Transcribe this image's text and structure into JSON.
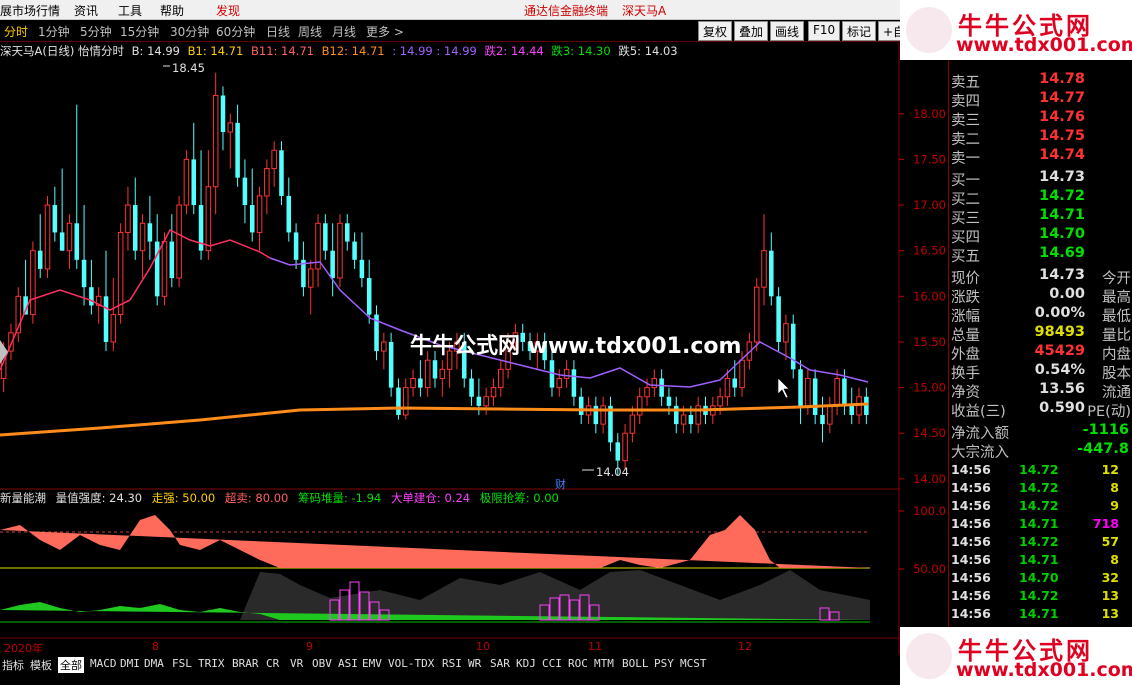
{
  "menubar": {
    "items": [
      "展市场行情",
      "资讯",
      "工具",
      "帮助",
      "发现"
    ],
    "center1": "通达信金融终端",
    "center2": "深天马A"
  },
  "periods": [
    "分时",
    "1分钟",
    "5分钟",
    "15分钟",
    "30分钟",
    "60分钟",
    "日线",
    "周线",
    "月线",
    "更多 >"
  ],
  "toolbar": {
    "b1": "复权",
    "b2": "叠加",
    "b3": "画线",
    "b4": "F10",
    "b5": "标记",
    "b6": "+自选"
  },
  "info": {
    "name": "深天马A(日线) 怡情分时",
    "b": "B: 14.99",
    "b1": "B1: 14.71",
    "b11": "B11: 14.71",
    "b12": "B12: 14.71",
    "v": ": 14.99 : 14.99",
    "d2": "跌2: 14.44",
    "d3": "跌3: 14.30",
    "d5": "跌5: 14.03"
  },
  "price_axis": [
    "18.00",
    "17.50",
    "17.00",
    "16.50",
    "16.00",
    "15.50",
    "15.00",
    "14.50",
    "14.00"
  ],
  "annotations": {
    "high": "18.45",
    "low": "14.04",
    "cai": "财"
  },
  "watermark": "牛牛公式网  www.tdx001.com",
  "indicator": {
    "name": "新量能潮",
    "strength": "量值强度: 24.30",
    "walk": "走强: 50.00",
    "over": "超卖: 80.00",
    "chip": "筹码堆量: -1.94",
    "big": "大单建仓: 0.24",
    "limit": "极限抢筹: 0.00"
  },
  "ind_axis": [
    "100.0",
    "50.00"
  ],
  "date_axis": {
    "year": "2020年",
    "m8": "8",
    "m9": "9",
    "m10": "10",
    "m11": "11",
    "m12": "12"
  },
  "bottombar": [
    "指标",
    "模板",
    "全部",
    "MACD",
    "DMI",
    "DMA",
    "FSL",
    "TRIX",
    "BRAR",
    "CR",
    "VR",
    "OBV",
    "ASI",
    "EMV",
    "VOL-TDX",
    "RSI",
    "WR",
    "SAR",
    "KDJ",
    "CCI",
    "ROC",
    "MTM",
    "BOLL",
    "PSY",
    "MCST"
  ],
  "quote": {
    "sell": [
      {
        "k": "卖五",
        "v": "14.78"
      },
      {
        "k": "卖四",
        "v": "14.77"
      },
      {
        "k": "卖三",
        "v": "14.76"
      },
      {
        "k": "卖二",
        "v": "14.75"
      },
      {
        "k": "卖一",
        "v": "14.74"
      }
    ],
    "buy": [
      {
        "k": "买一",
        "v": "14.73"
      },
      {
        "k": "买二",
        "v": "14.72"
      },
      {
        "k": "买三",
        "v": "14.71"
      },
      {
        "k": "买四",
        "v": "14.70"
      },
      {
        "k": "买五",
        "v": "14.69"
      }
    ],
    "stats": [
      {
        "k": "现价",
        "v": "14.73",
        "k2": "今开"
      },
      {
        "k": "涨跌",
        "v": "0.00",
        "k2": "最高"
      },
      {
        "k": "涨幅",
        "v": "0.00%",
        "k2": "最低"
      },
      {
        "k": "总量",
        "v": "98493",
        "k2": "量比"
      },
      {
        "k": "外盘",
        "v": "45429",
        "k2": "内盘"
      },
      {
        "k": "换手",
        "v": "0.54%",
        "k2": "股本"
      },
      {
        "k": "净资",
        "v": "13.56",
        "k2": "流通"
      },
      {
        "k": "收益(三)",
        "v": "0.590",
        "k2": "PE(动)"
      }
    ],
    "flows": [
      {
        "k": "净流入额",
        "v": "-1116"
      },
      {
        "k": "大宗流入",
        "v": "-447.8"
      }
    ],
    "ticks": [
      {
        "t": "14:56",
        "p": "14.72",
        "q": "12",
        "c": "#e0e000"
      },
      {
        "t": "14:56",
        "p": "14.72",
        "q": "8",
        "c": "#e0e000"
      },
      {
        "t": "14:56",
        "p": "14.72",
        "q": "9",
        "c": "#e0e000"
      },
      {
        "t": "14:56",
        "p": "14.71",
        "q": "718",
        "c": "#ff00ff"
      },
      {
        "t": "14:56",
        "p": "14.72",
        "q": "57",
        "c": "#e0e000"
      },
      {
        "t": "14:56",
        "p": "14.71",
        "q": "8",
        "c": "#e0e000"
      },
      {
        "t": "14:56",
        "p": "14.70",
        "q": "32",
        "c": "#e0e000"
      },
      {
        "t": "14:56",
        "p": "14.72",
        "q": "13",
        "c": "#e0e000"
      },
      {
        "t": "14:56",
        "p": "14.71",
        "q": "13",
        "c": "#e0e000"
      }
    ]
  },
  "logo": {
    "line1": "牛牛公式网",
    "line2": "www.tdx001.com"
  },
  "colors": {
    "up": "#ff3232",
    "down": "#54ffff",
    "ma_red": "#ff3060",
    "ma_purple": "#a060ff",
    "ma_orange": "#ff8c1a",
    "positive": "#ff3232",
    "negative": "#00e000"
  },
  "chart_data": {
    "type": "candlestick",
    "ylim": [
      13.9,
      18.6
    ],
    "candles": [
      [
        15.1,
        15.5,
        14.95,
        15.4
      ],
      [
        15.4,
        15.7,
        15.3,
        15.6
      ],
      [
        15.6,
        16.1,
        15.5,
        16.0
      ],
      [
        16.0,
        16.4,
        15.8,
        15.8
      ],
      [
        15.8,
        16.6,
        15.7,
        16.5
      ],
      [
        16.5,
        16.9,
        16.2,
        16.3
      ],
      [
        16.3,
        17.1,
        16.2,
        17.0
      ],
      [
        17.0,
        17.2,
        16.6,
        16.7
      ],
      [
        16.7,
        17.4,
        16.5,
        16.5
      ],
      [
        16.5,
        16.9,
        16.3,
        16.8
      ],
      [
        16.8,
        18.1,
        16.3,
        16.4
      ],
      [
        16.4,
        17.0,
        15.9,
        16.1
      ],
      [
        16.1,
        16.4,
        15.8,
        15.9
      ],
      [
        15.9,
        16.1,
        15.7,
        16.0
      ],
      [
        16.0,
        16.5,
        15.4,
        15.5
      ],
      [
        15.5,
        16.2,
        15.4,
        15.8
      ],
      [
        15.8,
        16.8,
        15.7,
        16.7
      ],
      [
        16.7,
        17.2,
        16.5,
        17.0
      ],
      [
        17.0,
        17.3,
        16.4,
        16.5
      ],
      [
        16.5,
        16.9,
        16.2,
        16.8
      ],
      [
        16.8,
        17.1,
        16.4,
        16.6
      ],
      [
        16.6,
        16.9,
        15.9,
        16.0
      ],
      [
        16.0,
        16.7,
        15.9,
        16.6
      ],
      [
        16.6,
        16.9,
        16.1,
        16.2
      ],
      [
        16.2,
        17.1,
        16.1,
        17.0
      ],
      [
        17.0,
        17.6,
        16.9,
        17.5
      ],
      [
        17.5,
        17.9,
        16.9,
        17.0
      ],
      [
        17.0,
        17.6,
        16.4,
        16.5
      ],
      [
        16.5,
        17.6,
        16.4,
        17.2
      ],
      [
        17.2,
        18.45,
        16.9,
        18.2
      ],
      [
        18.2,
        18.3,
        17.6,
        17.8
      ],
      [
        17.8,
        18.0,
        17.4,
        17.9
      ],
      [
        17.9,
        18.1,
        17.2,
        17.3
      ],
      [
        17.3,
        17.5,
        16.8,
        17.0
      ],
      [
        17.0,
        17.4,
        16.6,
        16.7
      ],
      [
        16.7,
        17.2,
        16.5,
        17.1
      ],
      [
        17.1,
        17.5,
        16.9,
        17.4
      ],
      [
        17.4,
        17.7,
        17.2,
        17.6
      ],
      [
        17.6,
        17.7,
        17.0,
        17.1
      ],
      [
        17.1,
        17.3,
        16.6,
        16.7
      ],
      [
        16.7,
        16.8,
        16.3,
        16.4
      ],
      [
        16.4,
        16.6,
        16.0,
        16.1
      ],
      [
        16.1,
        16.4,
        15.8,
        16.3
      ],
      [
        16.3,
        16.9,
        16.1,
        16.8
      ],
      [
        16.8,
        16.9,
        16.4,
        16.5
      ],
      [
        16.5,
        16.8,
        16.0,
        16.2
      ],
      [
        16.2,
        16.9,
        16.1,
        16.8
      ],
      [
        16.8,
        16.9,
        16.5,
        16.6
      ],
      [
        16.6,
        16.7,
        16.3,
        16.4
      ],
      [
        16.4,
        16.7,
        16.1,
        16.2
      ],
      [
        16.2,
        16.4,
        15.7,
        15.8
      ],
      [
        15.8,
        15.9,
        15.3,
        15.4
      ],
      [
        15.4,
        15.6,
        15.2,
        15.5
      ],
      [
        15.5,
        15.6,
        14.9,
        15.0
      ],
      [
        15.0,
        15.1,
        14.65,
        14.7
      ],
      [
        14.7,
        15.1,
        14.65,
        15.0
      ],
      [
        15.0,
        15.2,
        14.9,
        15.1
      ],
      [
        15.1,
        15.3,
        14.9,
        15.0
      ],
      [
        15.0,
        15.4,
        14.9,
        15.3
      ],
      [
        15.3,
        15.4,
        15.0,
        15.1
      ],
      [
        15.1,
        15.3,
        14.9,
        15.2
      ],
      [
        15.2,
        15.5,
        15.0,
        15.4
      ],
      [
        15.4,
        15.6,
        15.2,
        15.5
      ],
      [
        15.5,
        15.6,
        15.0,
        15.1
      ],
      [
        15.1,
        15.2,
        14.8,
        14.9
      ],
      [
        14.9,
        15.1,
        14.7,
        14.8
      ],
      [
        14.8,
        15.0,
        14.7,
        14.9
      ],
      [
        14.9,
        15.1,
        14.8,
        15.0
      ],
      [
        15.0,
        15.3,
        14.9,
        15.2
      ],
      [
        15.2,
        15.6,
        15.1,
        15.5
      ],
      [
        15.5,
        15.7,
        15.4,
        15.6
      ],
      [
        15.6,
        15.7,
        15.4,
        15.5
      ],
      [
        15.5,
        15.6,
        15.3,
        15.4
      ],
      [
        15.4,
        15.6,
        15.2,
        15.5
      ],
      [
        15.5,
        15.6,
        15.2,
        15.3
      ],
      [
        15.3,
        15.4,
        14.9,
        15.0
      ],
      [
        15.0,
        15.2,
        14.9,
        15.1
      ],
      [
        15.1,
        15.3,
        15.0,
        15.2
      ],
      [
        15.2,
        15.3,
        14.8,
        14.9
      ],
      [
        14.9,
        15.0,
        14.6,
        14.7
      ],
      [
        14.7,
        14.9,
        14.6,
        14.8
      ],
      [
        14.8,
        14.9,
        14.5,
        14.6
      ],
      [
        14.6,
        14.9,
        14.5,
        14.8
      ],
      [
        14.8,
        14.9,
        14.3,
        14.4
      ],
      [
        14.4,
        14.5,
        14.04,
        14.2
      ],
      [
        14.2,
        14.6,
        14.1,
        14.5
      ],
      [
        14.5,
        14.8,
        14.4,
        14.7
      ],
      [
        14.7,
        15.0,
        14.6,
        14.9
      ],
      [
        14.9,
        15.1,
        14.8,
        15.0
      ],
      [
        15.0,
        15.2,
        14.9,
        15.1
      ],
      [
        15.1,
        15.2,
        14.8,
        14.9
      ],
      [
        14.9,
        15.0,
        14.7,
        14.8
      ],
      [
        14.8,
        14.9,
        14.5,
        14.6
      ],
      [
        14.6,
        14.8,
        14.5,
        14.7
      ],
      [
        14.7,
        14.8,
        14.5,
        14.6
      ],
      [
        14.6,
        14.9,
        14.5,
        14.8
      ],
      [
        14.8,
        14.9,
        14.6,
        14.7
      ],
      [
        14.7,
        14.9,
        14.6,
        14.8
      ],
      [
        14.8,
        15.0,
        14.7,
        14.9
      ],
      [
        14.9,
        15.2,
        14.8,
        15.1
      ],
      [
        15.1,
        15.3,
        14.9,
        15.0
      ],
      [
        15.0,
        15.4,
        14.9,
        15.3
      ],
      [
        15.3,
        15.6,
        15.2,
        15.5
      ],
      [
        15.5,
        16.2,
        15.4,
        16.1
      ],
      [
        16.1,
        16.9,
        15.9,
        16.5
      ],
      [
        16.5,
        16.7,
        15.9,
        16.0
      ],
      [
        16.0,
        16.1,
        15.4,
        15.5
      ],
      [
        15.5,
        15.8,
        15.3,
        15.7
      ],
      [
        15.7,
        15.8,
        15.1,
        15.2
      ],
      [
        15.2,
        15.3,
        14.6,
        14.8
      ],
      [
        14.8,
        15.2,
        14.7,
        15.1
      ],
      [
        15.1,
        15.2,
        14.6,
        14.7
      ],
      [
        14.7,
        14.9,
        14.4,
        14.6
      ],
      [
        14.6,
        14.9,
        14.5,
        14.8
      ],
      [
        14.8,
        15.2,
        14.7,
        15.1
      ],
      [
        15.1,
        15.2,
        14.7,
        14.8
      ],
      [
        14.8,
        15.0,
        14.6,
        14.7
      ],
      [
        14.7,
        15.0,
        14.6,
        14.9
      ],
      [
        14.9,
        15.0,
        14.6,
        14.7
      ]
    ],
    "ma_purple_points": [
      [
        270,
        258
      ],
      [
        290,
        265
      ],
      [
        320,
        262
      ],
      [
        340,
        290
      ],
      [
        370,
        318
      ],
      [
        400,
        330
      ],
      [
        440,
        345
      ],
      [
        480,
        355
      ],
      [
        520,
        365
      ],
      [
        560,
        375
      ],
      [
        590,
        378
      ],
      [
        620,
        368
      ],
      [
        650,
        385
      ],
      [
        690,
        387
      ],
      [
        720,
        380
      ],
      [
        760,
        342
      ],
      [
        790,
        358
      ],
      [
        810,
        370
      ],
      [
        840,
        375
      ],
      [
        868,
        382
      ]
    ],
    "ma_red_points": [
      [
        0,
        370
      ],
      [
        30,
        300
      ],
      [
        60,
        290
      ],
      [
        90,
        300
      ],
      [
        110,
        310
      ],
      [
        130,
        300
      ],
      [
        150,
        268
      ],
      [
        170,
        230
      ],
      [
        190,
        240
      ],
      [
        210,
        246
      ],
      [
        230,
        240
      ],
      [
        260,
        252
      ],
      [
        270,
        258
      ]
    ],
    "ma_orange_points": [
      [
        0,
        435
      ],
      [
        100,
        428
      ],
      [
        200,
        420
      ],
      [
        300,
        410
      ],
      [
        400,
        408
      ],
      [
        500,
        409
      ],
      [
        600,
        410
      ],
      [
        700,
        410
      ],
      [
        800,
        407
      ],
      [
        868,
        404
      ]
    ],
    "indicator_red_area": [
      [
        0,
        530
      ],
      [
        20,
        525
      ],
      [
        40,
        540
      ],
      [
        60,
        550
      ],
      [
        80,
        535
      ],
      [
        100,
        545
      ],
      [
        120,
        550
      ],
      [
        140,
        520
      ],
      [
        155,
        515
      ],
      [
        170,
        530
      ],
      [
        180,
        545
      ],
      [
        200,
        550
      ],
      [
        220,
        540
      ],
      [
        240,
        550
      ],
      [
        260,
        560
      ],
      [
        280,
        568
      ],
      [
        600,
        568
      ],
      [
        620,
        560
      ],
      [
        640,
        565
      ],
      [
        660,
        568
      ],
      [
        690,
        560
      ],
      [
        710,
        535
      ],
      [
        725,
        530
      ],
      [
        740,
        515
      ],
      [
        755,
        530
      ],
      [
        770,
        560
      ],
      [
        780,
        568
      ],
      [
        870,
        568
      ]
    ],
    "indicator_green_area": [
      [
        0,
        610
      ],
      [
        20,
        605
      ],
      [
        40,
        602
      ],
      [
        60,
        608
      ],
      [
        80,
        612
      ],
      [
        100,
        610
      ],
      [
        120,
        606
      ],
      [
        140,
        608
      ],
      [
        160,
        604
      ],
      [
        180,
        610
      ],
      [
        200,
        612
      ],
      [
        220,
        608
      ],
      [
        240,
        612
      ],
      [
        260,
        614
      ],
      [
        280,
        620
      ],
      [
        870,
        620
      ]
    ],
    "indicator_magenta_bars": [
      [
        330,
        600
      ],
      [
        340,
        590
      ],
      [
        350,
        582
      ],
      [
        360,
        592
      ],
      [
        370,
        602
      ],
      [
        380,
        610
      ],
      [
        540,
        605
      ],
      [
        550,
        598
      ],
      [
        560,
        595
      ],
      [
        570,
        600
      ],
      [
        580,
        595
      ],
      [
        590,
        605
      ],
      [
        820,
        608
      ],
      [
        830,
        612
      ]
    ]
  }
}
